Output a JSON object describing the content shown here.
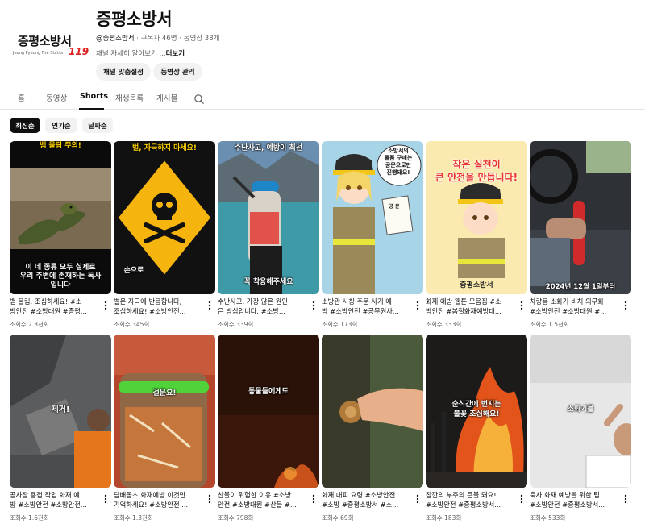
{
  "channel": {
    "avatar_name": "증평소방서",
    "avatar_sub": "Jeung Pyeong Fire Station",
    "avatar_119": "119",
    "title": "증평소방서",
    "handle": "@증평소방서",
    "stats": " · 구독자 46명 · 동영상 38개",
    "description": "채널 자세히 알아보기 ...",
    "more_label": "더보기",
    "customize_button": "채널 맞춤설정",
    "manage_button": "동영상 관리"
  },
  "tabs": [
    "홈",
    "동영상",
    "Shorts",
    "재생목록",
    "게시물"
  ],
  "active_tab": "Shorts",
  "chips": [
    "최신순",
    "인기순",
    "날짜순"
  ],
  "active_chip": "최신순",
  "videos": [
    {
      "title1": "뱀 물림, 조심하세요! #소",
      "title2": "방안전 #소방대원 #증평...",
      "views": "조회수 2.3천회",
      "captions": [
        "뱀 물림 주의!",
        "이 네 종류 모두 실제로",
        "우리 주변에 존재하는 독사",
        "입니다"
      ]
    },
    {
      "title1": "벌은 자극에 반응합니다,",
      "title2": "조심하세요! #소방안전...",
      "views": "조회수 345회",
      "captions": [
        "벌, 자극하지 마세요!",
        "손으로"
      ]
    },
    {
      "title1": "수난사고, 가장 많은 원인",
      "title2": "은 방심입니다. #소방...",
      "views": "조회수 339회",
      "captions": [
        "수난사고, 예방이 최선",
        "꼭 착용해주세요"
      ]
    },
    {
      "title1": "소방관 사칭 주문 사기 예",
      "title2": "방 #소방안전 #공무원사...",
      "views": "조회수 173회",
      "captions": [
        "소방서의",
        "물품 구매는",
        "공문으로만",
        "진행돼요!",
        "공 문"
      ]
    },
    {
      "title1": "화재 예방 웹툰 모음집 #소",
      "title2": "방안전 #봄철화재예방대...",
      "views": "조회수 333회",
      "captions": [
        "작은 실천이",
        "큰 안전을 만듭니다!",
        "증평소방서"
      ]
    },
    {
      "title1": "차량용 소화기 비치 의무화",
      "title2": "#소방안전 #소방대원 #...",
      "views": "조회수 1.5천회",
      "captions": [
        "2024년 12월 1일부터"
      ]
    },
    {
      "title1": "공사장 용접 작업 화재 예",
      "title2": "방 #소방안전 #소방안전...",
      "views": "조회수 1.6천회",
      "captions": [
        "제거!"
      ]
    },
    {
      "title1": "담배꽁초 화재예방 이것만",
      "title2": "기억하세요! #소방안전 ...",
      "views": "조회수 1.3천회",
      "captions": [
        "걸뮨요!"
      ]
    },
    {
      "title1": "산불이 위험한 이유 #소방",
      "title2": "안전 #소방대원 #산불 #...",
      "views": "조회수 798회",
      "captions": [
        "동물들에게도"
      ]
    },
    {
      "title1": "화재 대피 요령 #소방안전",
      "title2": "#소방 #증평소방서 #소...",
      "views": "조회수 69회",
      "captions": []
    },
    {
      "title1": "잠깐의 부주의 큰불 돼요!",
      "title2": "#소방안전 #증평소방서...",
      "views": "조회수 183회",
      "captions": [
        "순식간에 번지는",
        "불꽃 조심해요!"
      ]
    },
    {
      "title1": "축사 화재 예방을 위한 팁",
      "title2": "#소방안전 #증평소방서...",
      "views": "조회수 533회",
      "captions": [
        "소화기를"
      ]
    }
  ]
}
